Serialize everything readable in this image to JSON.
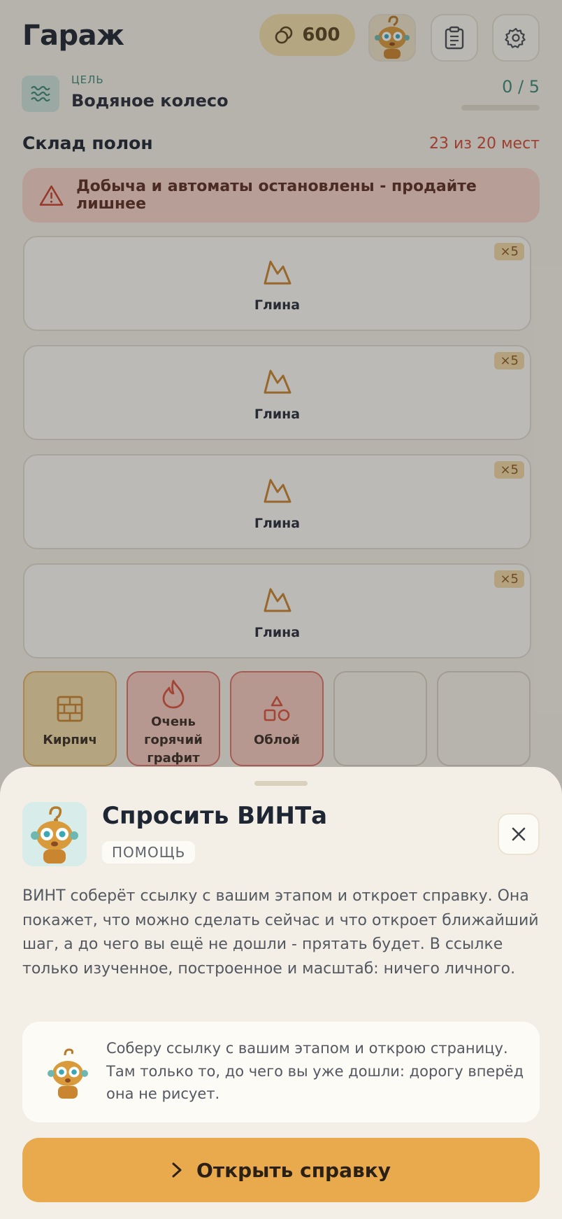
{
  "header": {
    "title": "Гараж",
    "coins": "600",
    "icons": [
      "coin-icon",
      "robot-avatar",
      "clipboard-icon",
      "gear-icon"
    ]
  },
  "goal": {
    "caption": "ЦЕЛЬ",
    "name": "Водяное колесо",
    "count": "0 / 5",
    "progress": 0
  },
  "storage": {
    "title": "Склад полон",
    "capacity": "23 из 20 мест",
    "warning": "Добыча и автоматы остановлены - продайте лишнее"
  },
  "resources": [
    {
      "label": "Глина",
      "badge": "×5"
    },
    {
      "label": "Глина",
      "badge": "×5"
    },
    {
      "label": "Глина",
      "badge": "×5"
    },
    {
      "label": "Глина",
      "badge": "×5"
    }
  ],
  "slots": [
    {
      "label": "Кирпич",
      "icon": "brick-icon"
    },
    {
      "label": "Очень горячий графит",
      "icon": "flame-icon"
    },
    {
      "label": "Облой",
      "icon": "shapes-icon"
    },
    {
      "label": "",
      "icon": ""
    },
    {
      "label": "",
      "icon": ""
    }
  ],
  "sheet": {
    "title": "Спросить ВИНТа",
    "tag": "ПОМОЩЬ",
    "description": "ВИНТ соберёт ссылку с вашим этапом и откроет справку. Она покажет, что можно сделать сейчас и что откроет ближайший шаг, а до чего вы ещё не дошли - прятать будет. В ссылке только изученное, построенное и масштаб: ничего личного.",
    "tip": "Соберу ссылку с вашим этапом и открою страницу. Там только то, до чего вы уже дошли: дорогу вперёд она не рисует.",
    "cta": "Открыть справку"
  },
  "colors": {
    "accent": "#e8aa4c",
    "danger": "#d24b36",
    "teal": "#3f8a76",
    "background": "#f5f1e8"
  }
}
